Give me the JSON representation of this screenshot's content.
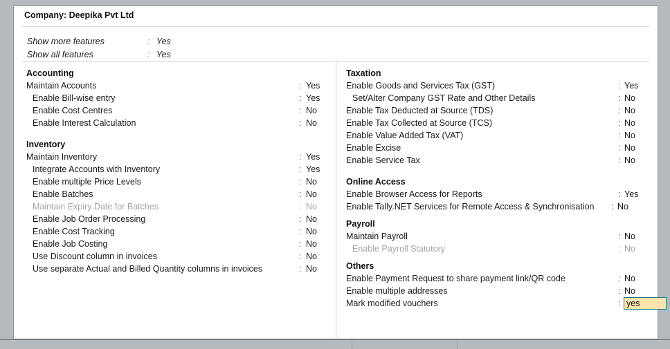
{
  "window": {
    "panel_title": "Company: Deepika Pvt Ltd"
  },
  "show_features": {
    "separator": ":",
    "rows": [
      {
        "label": "Show more features",
        "value": "Yes"
      },
      {
        "label": "Show all features",
        "value": "Yes"
      }
    ]
  },
  "separator": ":",
  "left_column": {
    "sections": [
      {
        "title": "Accounting",
        "rows": [
          {
            "label": "Maintain Accounts",
            "value": "Yes",
            "indent": false,
            "dim": false
          },
          {
            "label": "Enable Bill-wise entry",
            "value": "Yes",
            "indent": true,
            "dim": false
          },
          {
            "label": "Enable Cost Centres",
            "value": "No",
            "indent": true,
            "dim": false
          },
          {
            "label": "Enable Interest Calculation",
            "value": "No",
            "indent": true,
            "dim": false
          }
        ]
      },
      {
        "title": "Inventory",
        "rows": [
          {
            "label": "Maintain Inventory",
            "value": "Yes",
            "indent": false,
            "dim": false
          },
          {
            "label": "Integrate Accounts with Inventory",
            "value": "Yes",
            "indent": true,
            "dim": false
          },
          {
            "label": "Enable multiple Price Levels",
            "value": "No",
            "indent": true,
            "dim": false
          },
          {
            "label": "Enable Batches",
            "value": "No",
            "indent": true,
            "dim": false
          },
          {
            "label": "Maintain Expiry Date for Batches",
            "value": "No",
            "indent": true,
            "dim": true
          },
          {
            "label": "Enable Job Order Processing",
            "value": "No",
            "indent": true,
            "dim": false
          },
          {
            "label": "Enable Cost Tracking",
            "value": "No",
            "indent": true,
            "dim": false
          },
          {
            "label": "Enable Job Costing",
            "value": "No",
            "indent": true,
            "dim": false
          },
          {
            "label": "Use Discount column in invoices",
            "value": "No",
            "indent": true,
            "dim": false
          },
          {
            "label": "Use separate Actual and Billed Quantity columns in invoices",
            "value": "No",
            "indent": true,
            "dim": false
          }
        ]
      }
    ]
  },
  "right_column": {
    "sections": [
      {
        "title": "Taxation",
        "rows": [
          {
            "label": "Enable Goods and Services Tax (GST)",
            "value": "Yes",
            "indent": false,
            "dim": false
          },
          {
            "label": "Set/Alter Company GST Rate and Other Details",
            "value": "No",
            "indent": true,
            "dim": false
          },
          {
            "label": "Enable Tax Deducted at Source (TDS)",
            "value": "No",
            "indent": false,
            "dim": false
          },
          {
            "label": "Enable Tax Collected at Source (TCS)",
            "value": "No",
            "indent": false,
            "dim": false
          },
          {
            "label": "Enable Value Added Tax (VAT)",
            "value": "No",
            "indent": false,
            "dim": false
          },
          {
            "label": "Enable Excise",
            "value": "No",
            "indent": false,
            "dim": false
          },
          {
            "label": "Enable Service Tax",
            "value": "No",
            "indent": false,
            "dim": false
          }
        ]
      },
      {
        "title": "Online Access",
        "rows": [
          {
            "label": "Enable Browser Access for Reports",
            "value": "Yes",
            "indent": false,
            "dim": false
          },
          {
            "label": "Enable Tally.NET Services for Remote Access & Synchronisation",
            "value": "No",
            "indent": false,
            "dim": false,
            "tight": true
          }
        ]
      },
      {
        "title": "Payroll",
        "rows": [
          {
            "label": "Maintain Payroll",
            "value": "No",
            "indent": false,
            "dim": false
          },
          {
            "label": "Enable Payroll Statutory",
            "value": "No",
            "indent": true,
            "dim": true
          }
        ]
      },
      {
        "title": "Others",
        "rows": [
          {
            "label": "Enable Payment Request to share payment link/QR code",
            "value": "No",
            "indent": false,
            "dim": false
          },
          {
            "label": "Enable multiple addresses",
            "value": "No",
            "indent": false,
            "dim": false
          },
          {
            "label": "Mark modified vouchers",
            "value": "yes",
            "indent": false,
            "dim": false,
            "focused": true
          }
        ]
      }
    ]
  },
  "colors": {
    "field_background": "#fce3ab",
    "field_border": "#197c83",
    "chrome_gray": "#b6babe",
    "panel_background": "#ffffff",
    "text": "#1a1a1a",
    "dim_text": "#a3a3a3"
  }
}
